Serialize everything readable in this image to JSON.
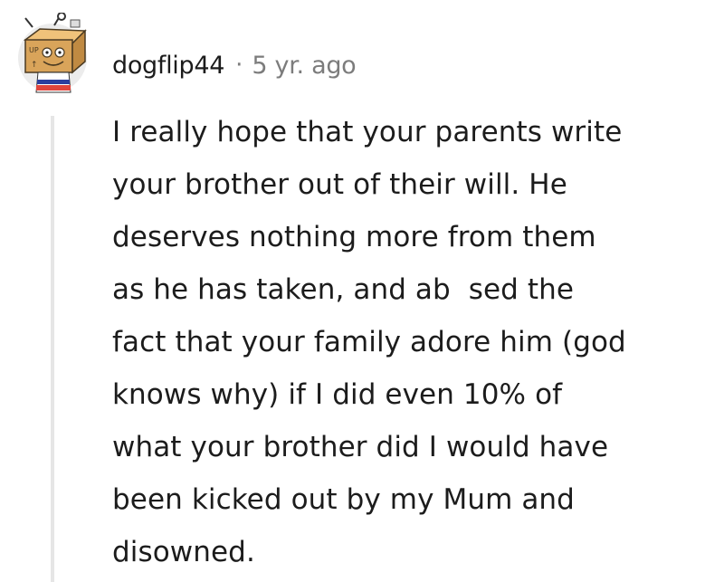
{
  "comment": {
    "author": "dogflip44",
    "separator": "·",
    "timestamp": "5 yr. ago",
    "avatar_icon": "snoo-box-robot-avatar-icon",
    "body_lines": [
      "I really hope that your parents write",
      "your brother out of their will. He",
      "deserves nothing more from them",
      "as he has taken, and ab  sed the",
      "fact that your family adore him (god",
      "knows why) if I did even 10% of",
      "what your brother did I would have",
      "been kicked out by my Mum and",
      "disowned."
    ]
  },
  "colors": {
    "text": "#1c1c1c",
    "meta": "#7c7c7c",
    "thread_line": "#e6e6e6",
    "avatar_box": "#d9a45a"
  }
}
